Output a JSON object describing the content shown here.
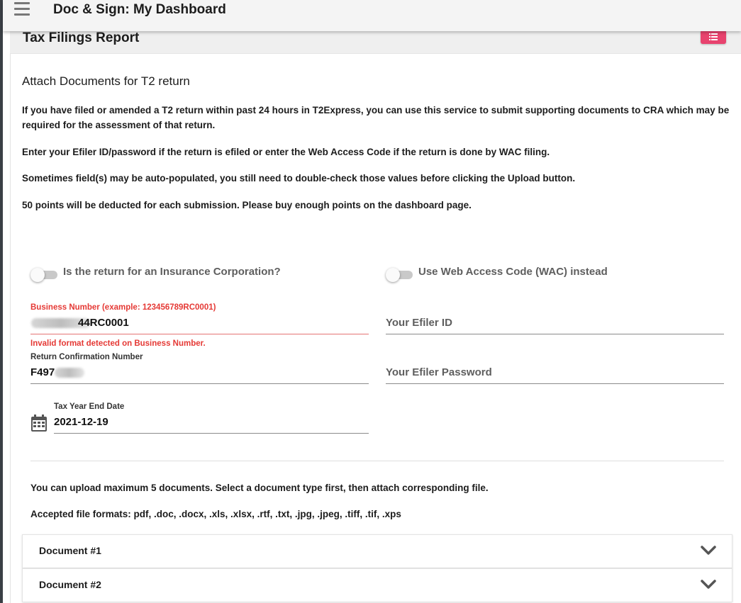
{
  "app": {
    "title": "Doc & Sign: My Dashboard",
    "menu_icon": "hamburger-menu-icon"
  },
  "card": {
    "title": "Tax Filings Report",
    "list_button_icon": "list-icon",
    "accent_color": "#e8436e"
  },
  "section": {
    "title": "Attach Documents for T2 return",
    "paragraphs": [
      "If you have filed or amended a T2 return within past 24 hours in T2Express, you can use this service to submit supporting documents to CRA which may be required for the assessment of that return.",
      "Enter your Efiler ID/password if the return is efiled or enter the Web Access Code if the return is done by WAC filing.",
      "Sometimes field(s) may be auto-populated, you still need to double-check those values before clicking the Upload button.",
      "50 points will be deducted for each submission. Please buy enough points on the dashboard page."
    ]
  },
  "toggles": {
    "insurance": {
      "label": "Is the return for an Insurance Corporation?",
      "checked": false
    },
    "wac": {
      "label": "Use Web Access Code (WAC) instead",
      "checked": false
    }
  },
  "form": {
    "business_number": {
      "label": "Business Number (example: 123456789RC0001)",
      "value_visible_suffix": "44RC0001",
      "error": "Invalid format detected on Business Number."
    },
    "return_confirmation": {
      "label": "Return Confirmation Number",
      "value_visible_prefix": "F497"
    },
    "tax_year_end": {
      "label": "Tax Year End Date",
      "value": "2021-12-19",
      "icon": "calendar-icon"
    },
    "efiler_id": {
      "placeholder": "Your Efiler ID"
    },
    "efiler_password": {
      "placeholder": "Your Efiler Password"
    }
  },
  "upload": {
    "info": "You can upload maximum 5 documents. Select a document type first, then attach corresponding file.",
    "formats": "Accepted file formats: pdf, .doc, .docx, .xls, .xlsx, .rtf, .txt, .jpg, .jpeg, .tiff, .tif, .xps",
    "documents": [
      {
        "title": "Document #1",
        "icon": "chevron-down-icon"
      },
      {
        "title": "Document #2",
        "icon": "chevron-down-icon"
      }
    ]
  }
}
